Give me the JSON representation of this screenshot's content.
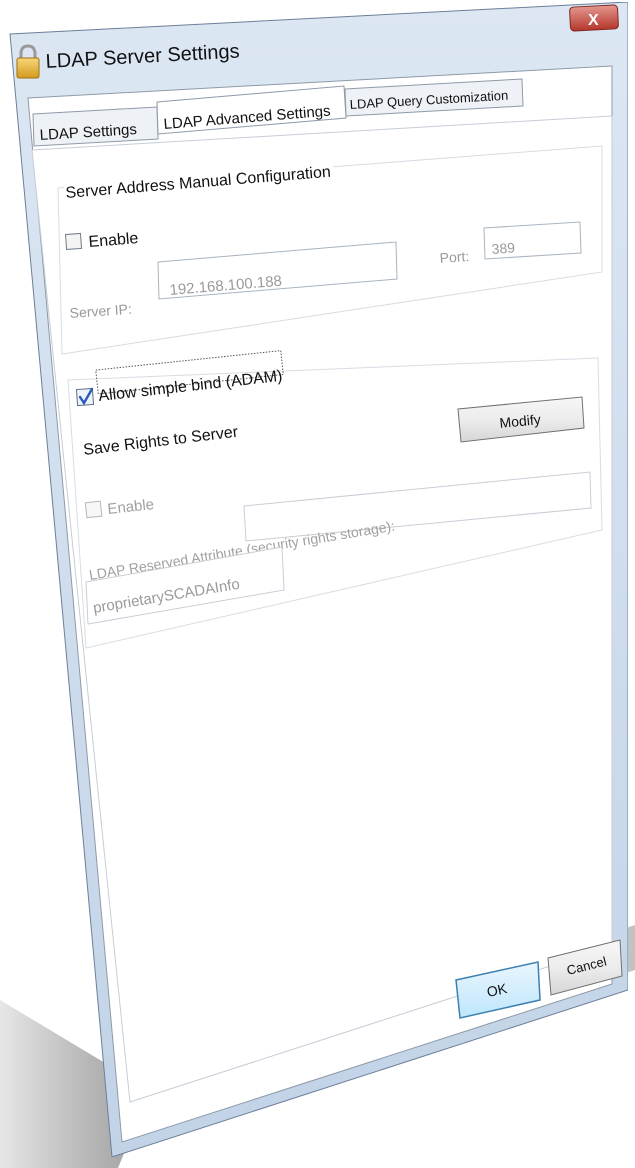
{
  "window": {
    "title": "LDAP Server Settings",
    "close_glyph": "X"
  },
  "tabs": [
    {
      "label": "LDAP Settings",
      "active": false
    },
    {
      "label": "LDAP Advanced Settings",
      "active": true
    },
    {
      "label": "LDAP Query Customization",
      "active": false
    }
  ],
  "server_address": {
    "group_title": "Server Address Manual Configuration",
    "enable_label": "Enable",
    "enable_checked": false,
    "port_label": "Port:",
    "port_value": "389",
    "server_ip_label": "Server IP:",
    "server_ip_value": "192.168.100.188"
  },
  "simple_bind": {
    "label": "Allow simple bind (ADAM)",
    "checked": true
  },
  "save_rights": {
    "group_title": "Save Rights to Server",
    "modify_label": "Modify",
    "enable_label": "Enable",
    "enable_checked": false,
    "attribute_label": "LDAP Reserved Attribute (security rights storage):",
    "attribute_value": "proprietarySCADAInfo"
  },
  "buttons": {
    "ok_label": "OK",
    "cancel_label": "Cancel"
  },
  "colors": {
    "window_frame": "#c4d4e6",
    "close_button": "#c9463d",
    "ok_border": "#3c7fb1",
    "check_blue": "#2a59b8"
  }
}
